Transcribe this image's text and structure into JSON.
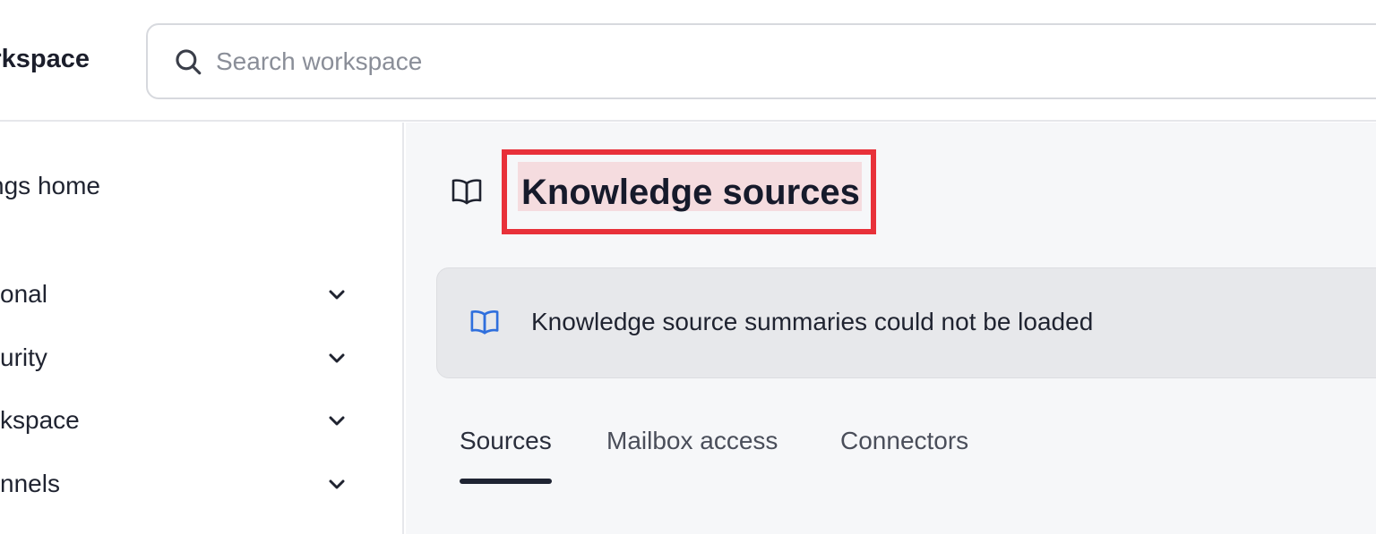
{
  "header": {
    "brand": "Workspace",
    "search": {
      "placeholder": "Search workspace",
      "value": ""
    }
  },
  "sidebar": {
    "home_label": "Settings home",
    "groups": [
      {
        "label": "onal"
      },
      {
        "label": "urity"
      },
      {
        "label": "kspace"
      },
      {
        "label": "nnels"
      }
    ]
  },
  "main": {
    "title": "Knowledge sources",
    "alert_text": "Knowledge source summaries could not be loaded",
    "tabs": [
      {
        "label": "Sources",
        "active": true
      },
      {
        "label": "Mailbox access",
        "active": false
      },
      {
        "label": "Connectors",
        "active": false
      }
    ]
  },
  "colors": {
    "highlight_border": "#e8313a",
    "alert_icon": "#2f6fdd",
    "active_tab_underline": "#1f2433"
  },
  "icons": {
    "search": "search-icon",
    "title": "book-open-icon",
    "alert": "book-open-icon",
    "chevron": "chevron-down-icon"
  }
}
